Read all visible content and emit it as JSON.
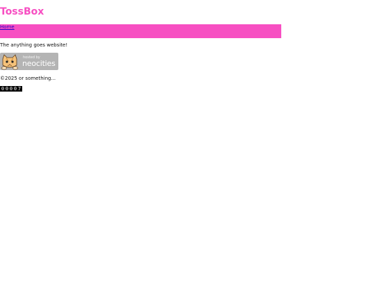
{
  "site": {
    "title": "TossBox",
    "tagline": "The anything goes website!",
    "copyright": "©2025 or something..."
  },
  "nav": {
    "items": [
      {
        "label": "Home"
      }
    ]
  },
  "badge": {
    "hosted_text": "hosted by",
    "name": "neocities"
  },
  "counter": {
    "digits": [
      "0",
      "0",
      "0",
      "0",
      "7"
    ]
  },
  "colors": {
    "accent": "#f74fc2",
    "link": "#2a00c8",
    "badge_bg": "#b4b4b4"
  }
}
